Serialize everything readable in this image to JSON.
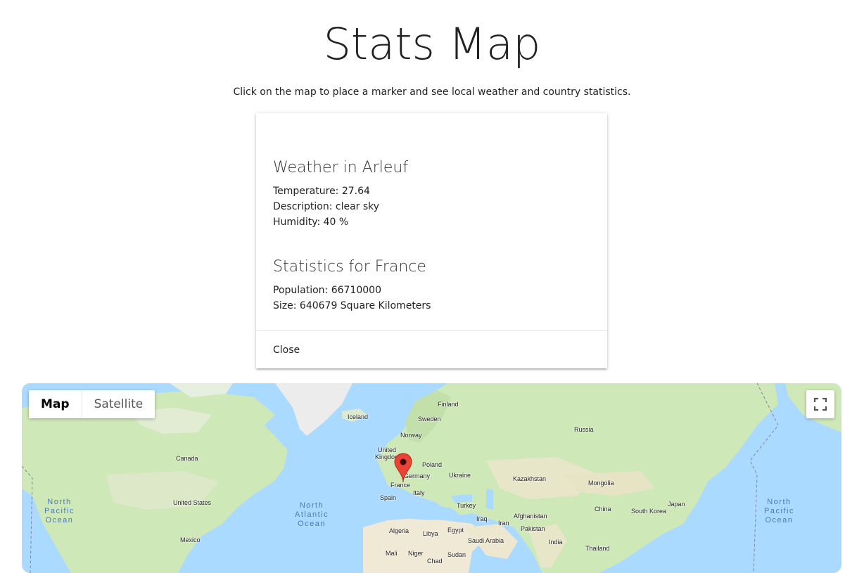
{
  "header": {
    "title": "Stats Map",
    "subtitle": "Click on the map to place a marker and see local weather and country statistics."
  },
  "card": {
    "weather_title": "Weather in Arleuf",
    "temperature": "Temperature: 27.64",
    "description": "Description: clear sky",
    "humidity": "Humidity: 40 %",
    "stats_title": "Statistics for France",
    "population": "Population: 66710000",
    "size": "Size: 640679 Square Kilometers",
    "close_label": "Close"
  },
  "map": {
    "type_controls": [
      "Map",
      "Satellite"
    ],
    "active_type": "Map",
    "countries": {
      "finland": "Finland",
      "iceland": "Iceland",
      "sweden": "Sweden",
      "norway": "Norway",
      "russia": "Russia",
      "united_kingdom_1": "United",
      "united_kingdom_2": "Kingdom",
      "poland": "Poland",
      "germany": "Germany",
      "ukraine": "Ukraine",
      "kazakhstan": "Kazakhstan",
      "mongolia": "Mongolia",
      "france": "France",
      "italy": "Italy",
      "spain": "Spain",
      "turkey": "Turkey",
      "china": "China",
      "south_korea": "South Korea",
      "japan": "Japan",
      "canada": "Canada",
      "united_states": "United States",
      "iraq": "Iraq",
      "afghanistan": "Afghanistan",
      "iran": "Iran",
      "pakistan": "Pakistan",
      "algeria": "Algeria",
      "libya": "Libya",
      "egypt": "Egypt",
      "saudi_arabia": "Saudi Arabia",
      "india": "India",
      "mexico": "Mexico",
      "mali": "Mali",
      "niger": "Niger",
      "chad": "Chad",
      "sudan": "Sudan",
      "thailand": "Thailand"
    },
    "oceans": {
      "north_pacific_left": [
        "North",
        "Pacific",
        "Ocean"
      ],
      "north_atlantic": [
        "North",
        "Atlantic",
        "Ocean"
      ],
      "north_pacific_right": [
        "North",
        "Pacific",
        "Ocean"
      ]
    },
    "colors": {
      "water": "#aadaff",
      "land": "#cfe8b8",
      "marker": "#ea4335"
    }
  }
}
